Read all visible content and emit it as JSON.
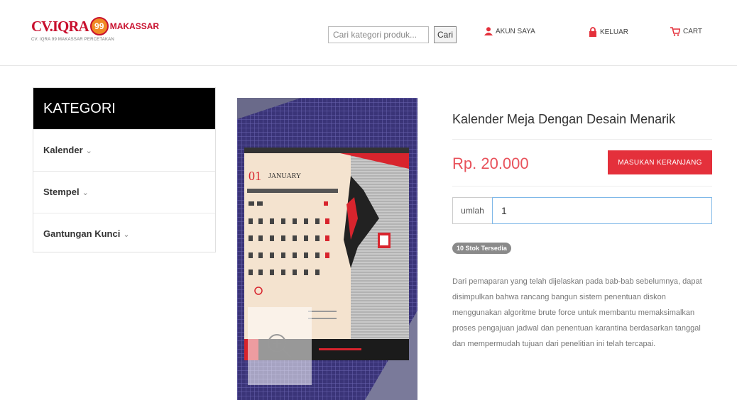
{
  "header": {
    "logo": {
      "cv": "CV.IQRA",
      "badge": "99",
      "city": "MAKASSAR",
      "tagline": "CV. IQRA 99 MAKASSAR PERCETAKAN"
    },
    "search": {
      "placeholder": "Cari kategori produk...",
      "button_label": "Cari"
    },
    "nav": {
      "account_label": "AKUN SAYA",
      "logout_label": "KELUAR",
      "cart_label": "CART"
    }
  },
  "sidebar": {
    "heading": "KATEGORI",
    "items": [
      {
        "label": "Kalender"
      },
      {
        "label": "Stempel"
      },
      {
        "label": "Gantungan Kunci"
      }
    ]
  },
  "product": {
    "title": "Kalender Meja Dengan Desain Menarik",
    "price": "Rp. 20.000",
    "add_to_cart_label": "MASUKAN KERANJANG",
    "quantity_label": "umlah",
    "quantity_value": "1",
    "stock_badge": "10 Stok Tersedia",
    "description": "Dari pemaparan yang telah dijelaskan pada bab-bab sebelumnya, dapat disimpulkan bahwa rancang bangun sistem penentuan diskon menggunakan algoritme brute force untuk membantu memaksimalkan proses pengajuan jadwal dan penentuan karantina berdasarkan tanggal dan mempermudah tujuan dari penelitian ini telah tercapai."
  },
  "image_text": {
    "calendar_day": "01",
    "calendar_month": "JANUARY"
  },
  "colors": {
    "accent_red": "#e4303b",
    "price_red": "#e8525b",
    "sidebar_head_bg": "#000000",
    "brand_orange": "#f08a24"
  }
}
